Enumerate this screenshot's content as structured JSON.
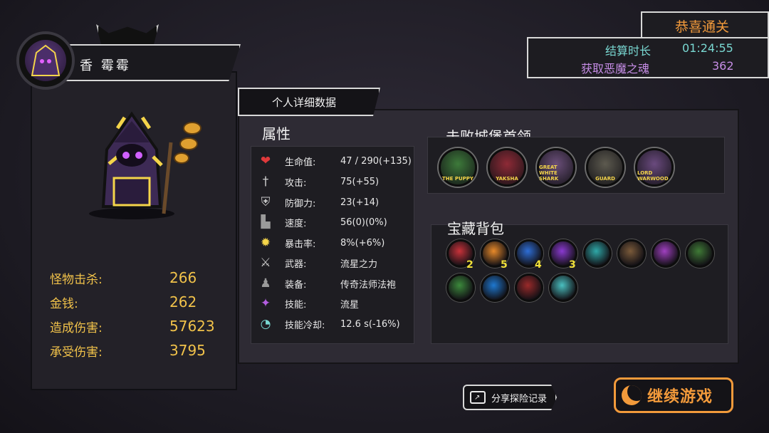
{
  "character": {
    "name": "香 霉霉",
    "stats": [
      {
        "label": "怪物击杀:",
        "value": "266"
      },
      {
        "label": "金钱:",
        "value": "262"
      },
      {
        "label": "造成伤害:",
        "value": "57623"
      },
      {
        "label": "承受伤害:",
        "value": "3795"
      }
    ]
  },
  "result": {
    "title": "恭喜通关",
    "duration_label": "结算时长",
    "duration_value": "01:24:55",
    "souls_label": "获取恶魔之魂",
    "souls_value": "362"
  },
  "details": {
    "tab_label": "个人详细数据",
    "attributes_title": "属性",
    "attributes": [
      {
        "icon": "heart-icon",
        "glyph": "❤",
        "color": "#e0393b",
        "label": "生命值:",
        "value": "47 / 290(+135)"
      },
      {
        "icon": "sword-icon",
        "glyph": "†",
        "color": "#c9c9c9",
        "label": "攻击:",
        "value": "75(+55)"
      },
      {
        "icon": "shield-icon",
        "glyph": "⛨",
        "color": "#c9c9c9",
        "label": "防御力:",
        "value": "23(+14)"
      },
      {
        "icon": "boot-icon",
        "glyph": "▙",
        "color": "#9a9a9a",
        "label": "速度:",
        "value": "56(0)(0%)"
      },
      {
        "icon": "crit-gear-icon",
        "glyph": "✹",
        "color": "#f5d54a",
        "label": "暴击率:",
        "value": "8%(+6%)"
      },
      {
        "icon": "weapon-icon",
        "glyph": "⚔",
        "color": "#c9c9c9",
        "label": "武器:",
        "value": "流星之力"
      },
      {
        "icon": "robe-icon",
        "glyph": "♟",
        "color": "#9a9a9a",
        "label": "装备:",
        "value": "传奇法师法袍"
      },
      {
        "icon": "skill-icon",
        "glyph": "✦",
        "color": "#b35de0",
        "label": "技能:",
        "value": "流星"
      },
      {
        "icon": "cooldown-icon",
        "glyph": "◔",
        "color": "#79d8d2",
        "label": "技能冷却:",
        "value": "12.6 s(-16%)"
      }
    ],
    "bosses_title": "击败城堡首领",
    "bosses": [
      {
        "name": "THE PUPPY",
        "color": "#3d7a3a"
      },
      {
        "name": "YAKSHA",
        "color": "#8e2a36"
      },
      {
        "name": "GREAT WHITE SHARK",
        "color": "#6b4f7a"
      },
      {
        "name": "GUARD",
        "color": "#5d5a4f"
      },
      {
        "name": "LORD WARWOOD",
        "color": "#6a4a7e"
      }
    ],
    "treasure_title": "宝藏背包",
    "treasures_row1": [
      {
        "icon": "red-crystal-icon",
        "color": "#c8323a",
        "count": "2"
      },
      {
        "icon": "orange-crystal-icon",
        "color": "#e88a2a",
        "count": "5"
      },
      {
        "icon": "blue-crystal-icon",
        "color": "#2e6ed6",
        "count": "4"
      },
      {
        "icon": "purple-crystal-icon",
        "color": "#8a3ad0",
        "count": "3"
      },
      {
        "icon": "frost-hammer-icon",
        "color": "#2fa8a8",
        "count": ""
      },
      {
        "icon": "horned-helm-icon",
        "color": "#7a5a3a",
        "count": ""
      },
      {
        "icon": "demon-face-icon",
        "color": "#a040c0",
        "count": ""
      },
      {
        "icon": "tree-spirit-icon",
        "color": "#3f7a36",
        "count": ""
      }
    ],
    "treasures_row2": [
      {
        "icon": "green-potion-icon",
        "color": "#3c8a3c",
        "count": ""
      },
      {
        "icon": "blue-eye-icon",
        "color": "#1e78d0",
        "count": ""
      },
      {
        "icon": "red-mask-icon",
        "color": "#9a2a2a",
        "count": ""
      },
      {
        "icon": "lightning-icon",
        "color": "#4ac0c0",
        "count": ""
      }
    ]
  },
  "buttons": {
    "share_label": "分享探险记录",
    "continue_label": "继续游戏"
  }
}
